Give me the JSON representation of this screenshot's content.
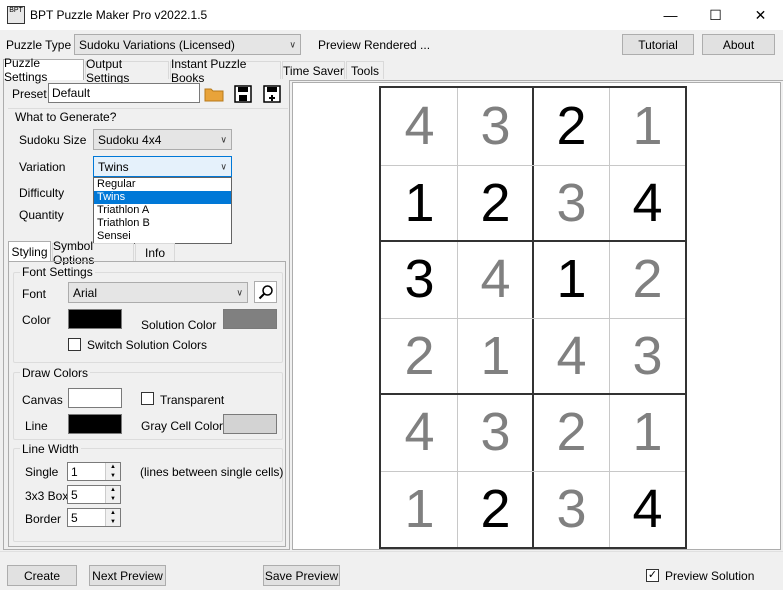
{
  "window": {
    "title": "BPT Puzzle Maker Pro v2022.1.5",
    "icon_text": "BPT"
  },
  "header": {
    "puzzle_type_label": "Puzzle Type",
    "puzzle_type_value": "Sudoku Variations (Licensed)",
    "status": "Preview Rendered ...",
    "tutorial": "Tutorial",
    "about": "About"
  },
  "tabs": [
    "Puzzle Settings",
    "Output Settings",
    "Instant Puzzle Books",
    "Time Saver",
    "Tools"
  ],
  "preset": {
    "label": "Preset",
    "value": "Default"
  },
  "generate": {
    "title": "What to Generate?",
    "size_label": "Sudoku Size",
    "size_value": "Sudoku  4x4",
    "variation_label": "Variation",
    "variation_value": "Twins",
    "difficulty_label": "Difficulty",
    "quantity_label": "Quantity",
    "variation_options": [
      "Regular",
      "Twins",
      "Triathlon A",
      "Triathlon B",
      "Sensei"
    ]
  },
  "subtabs": [
    "Styling",
    "Symbol Options",
    "Info"
  ],
  "font_settings": {
    "title": "Font Settings",
    "font_label": "Font",
    "font_value": "Arial",
    "color_label": "Color",
    "solution_color_label": "Solution Color",
    "switch_label": "Switch Solution Colors",
    "color": "#000000",
    "solution_color": "#808080"
  },
  "draw_colors": {
    "title": "Draw Colors",
    "canvas_label": "Canvas",
    "transparent_label": "Transparent",
    "line_label": "Line",
    "gray_cell_label": "Gray Cell Color",
    "canvas_color": "#ffffff",
    "line_color": "#000000",
    "gray_cell_color": "#d3d3d3"
  },
  "line_width": {
    "title": "Line Width",
    "single_label": "Single",
    "single_value": "1",
    "single_note": "(lines between single cells)",
    "box_label": "3x3 Box",
    "box_value": "5",
    "border_label": "Border",
    "border_value": "5"
  },
  "footer": {
    "create": "Create",
    "next_preview": "Next Preview",
    "save_preview": "Save Preview",
    "preview_solution": "Preview Solution",
    "preview_solution_checked": true
  },
  "puzzle": {
    "rows": [
      [
        {
          "v": "4",
          "given": false
        },
        {
          "v": "3",
          "given": false
        },
        {
          "v": "2",
          "given": true
        },
        {
          "v": "1",
          "given": false
        }
      ],
      [
        {
          "v": "1",
          "given": true
        },
        {
          "v": "2",
          "given": true
        },
        {
          "v": "3",
          "given": false
        },
        {
          "v": "4",
          "given": true
        }
      ],
      [
        {
          "v": "3",
          "given": true
        },
        {
          "v": "4",
          "given": false
        },
        {
          "v": "1",
          "given": true
        },
        {
          "v": "2",
          "given": false
        }
      ],
      [
        {
          "v": "2",
          "given": false
        },
        {
          "v": "1",
          "given": false
        },
        {
          "v": "4",
          "given": false
        },
        {
          "v": "3",
          "given": false
        }
      ],
      [
        {
          "v": "4",
          "given": false
        },
        {
          "v": "3",
          "given": false
        },
        {
          "v": "2",
          "given": false
        },
        {
          "v": "1",
          "given": false
        }
      ],
      [
        {
          "v": "1",
          "given": false
        },
        {
          "v": "2",
          "given": true
        },
        {
          "v": "3",
          "given": false
        },
        {
          "v": "4",
          "given": true
        }
      ]
    ],
    "given_color": "#000000",
    "solution_color": "#808080"
  }
}
